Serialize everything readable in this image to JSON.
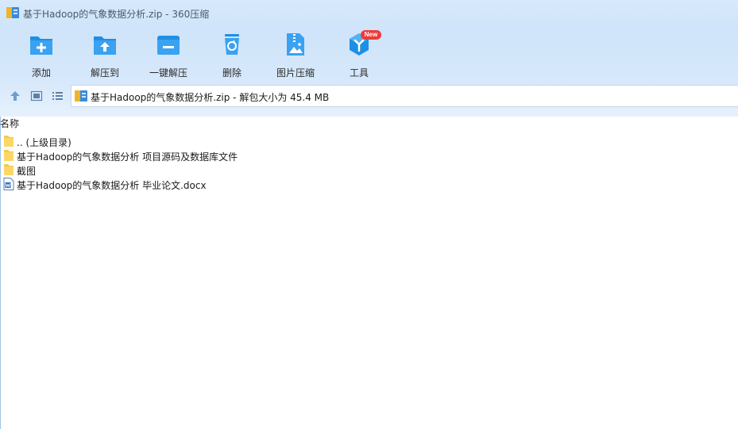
{
  "window": {
    "title": "基于Hadoop的气象数据分析.zip - 360压缩"
  },
  "colors": {
    "accent": "#1e8fe6",
    "header_bg": "#d3e6fa",
    "badge": "#ee3b3b",
    "folder": "#f5c94a"
  },
  "toolbar": {
    "items": [
      {
        "label": "添加",
        "icon": "add-folder-icon"
      },
      {
        "label": "解压到",
        "icon": "extract-to-icon"
      },
      {
        "label": "一键解压",
        "icon": "one-click-extract-icon"
      },
      {
        "label": "删除",
        "icon": "delete-trash-icon"
      },
      {
        "label": "图片压缩",
        "icon": "image-compress-icon"
      },
      {
        "label": "工具",
        "icon": "tools-cube-icon",
        "badge": "New"
      }
    ]
  },
  "navigation": {
    "buttons": [
      "up-arrow-icon",
      "thumbnail-view-icon",
      "list-view-icon"
    ],
    "path": "基于Hadoop的气象数据分析.zip - 解包大小为 45.4 MB"
  },
  "file_list": {
    "column_header": "名称",
    "rows": [
      {
        "name": ".. (上级目录)",
        "type": "folder"
      },
      {
        "name": "基于Hadoop的气象数据分析 项目源码及数据库文件",
        "type": "folder"
      },
      {
        "name": "截图",
        "type": "folder"
      },
      {
        "name": "基于Hadoop的气象数据分析 毕业论文.docx",
        "type": "word-document"
      }
    ]
  }
}
